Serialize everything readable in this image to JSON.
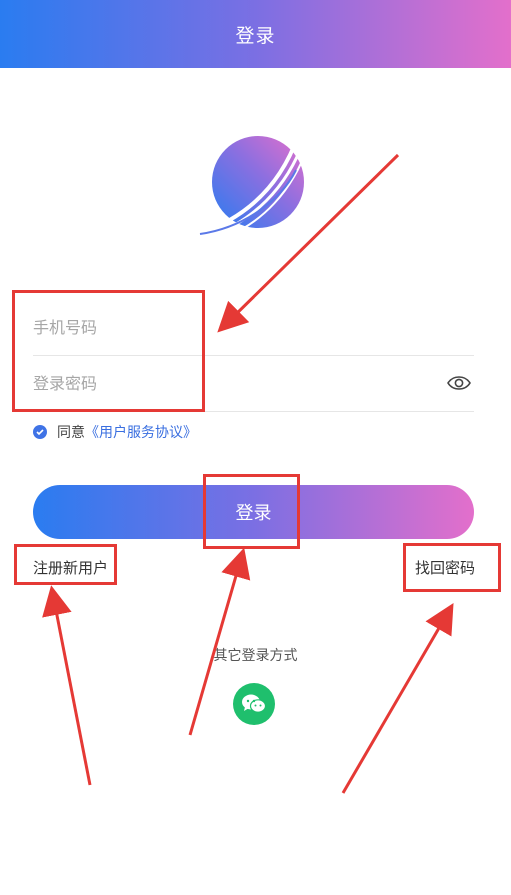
{
  "header": {
    "title": "登录"
  },
  "form": {
    "phone_placeholder": "手机号码",
    "password_placeholder": "登录密码",
    "agree_text": "同意",
    "agreement_link": "《用户服务协议》",
    "agree_checked": true
  },
  "actions": {
    "login_label": "登录",
    "register_label": "注册新用户",
    "forgot_label": "找回密码"
  },
  "social": {
    "other_login_label": "其它登录方式",
    "wechat_icon": "wechat-icon"
  },
  "colors": {
    "gradient_start": "#2a7cf0",
    "gradient_mid": "#7b6fe3",
    "gradient_end": "#e36fcb",
    "annotation": "#e53935",
    "wechat": "#1fbf6d",
    "link": "#3a6fe0"
  }
}
